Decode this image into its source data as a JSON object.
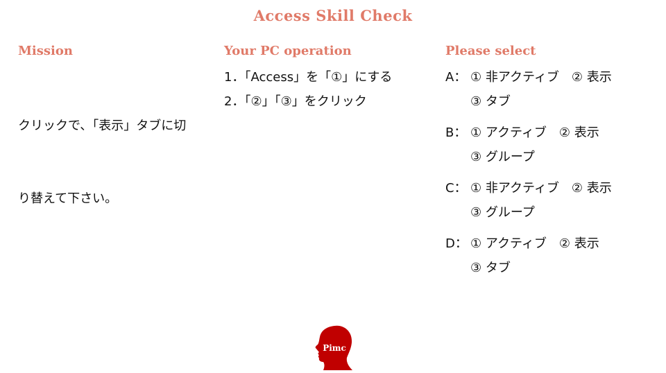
{
  "title": "Access Skill Check",
  "mission": {
    "heading": "Mission",
    "text": "クリックで、「表示」タブに切り替えて下さい。",
    "lines": [
      "クリックで、「表示」タブに切",
      "り替えて下さい。"
    ]
  },
  "operation": {
    "heading": "Your PC operation",
    "steps": [
      "1．「Access」を「①」にする",
      "2．「②」「③」をクリック"
    ]
  },
  "select": {
    "heading": "Please select",
    "options": [
      {
        "letter": "A：",
        "line1": "① 非アクティブ　② 表示",
        "line2": "③ タブ"
      },
      {
        "letter": "B：",
        "line1": "① アクティブ　② 表示",
        "line2": "③ グループ"
      },
      {
        "letter": "C：",
        "line1": "① 非アクティブ　② 表示",
        "line2": "③ グループ"
      },
      {
        "letter": "D：",
        "line1": "① アクティブ　② 表示",
        "line2": "③ タブ"
      }
    ]
  },
  "logo": {
    "text": "Pimc",
    "icon": "head-silhouette-icon",
    "color": "#c00000"
  },
  "colors": {
    "accent": "#e07a68",
    "text": "#111111",
    "logo": "#c00000"
  }
}
